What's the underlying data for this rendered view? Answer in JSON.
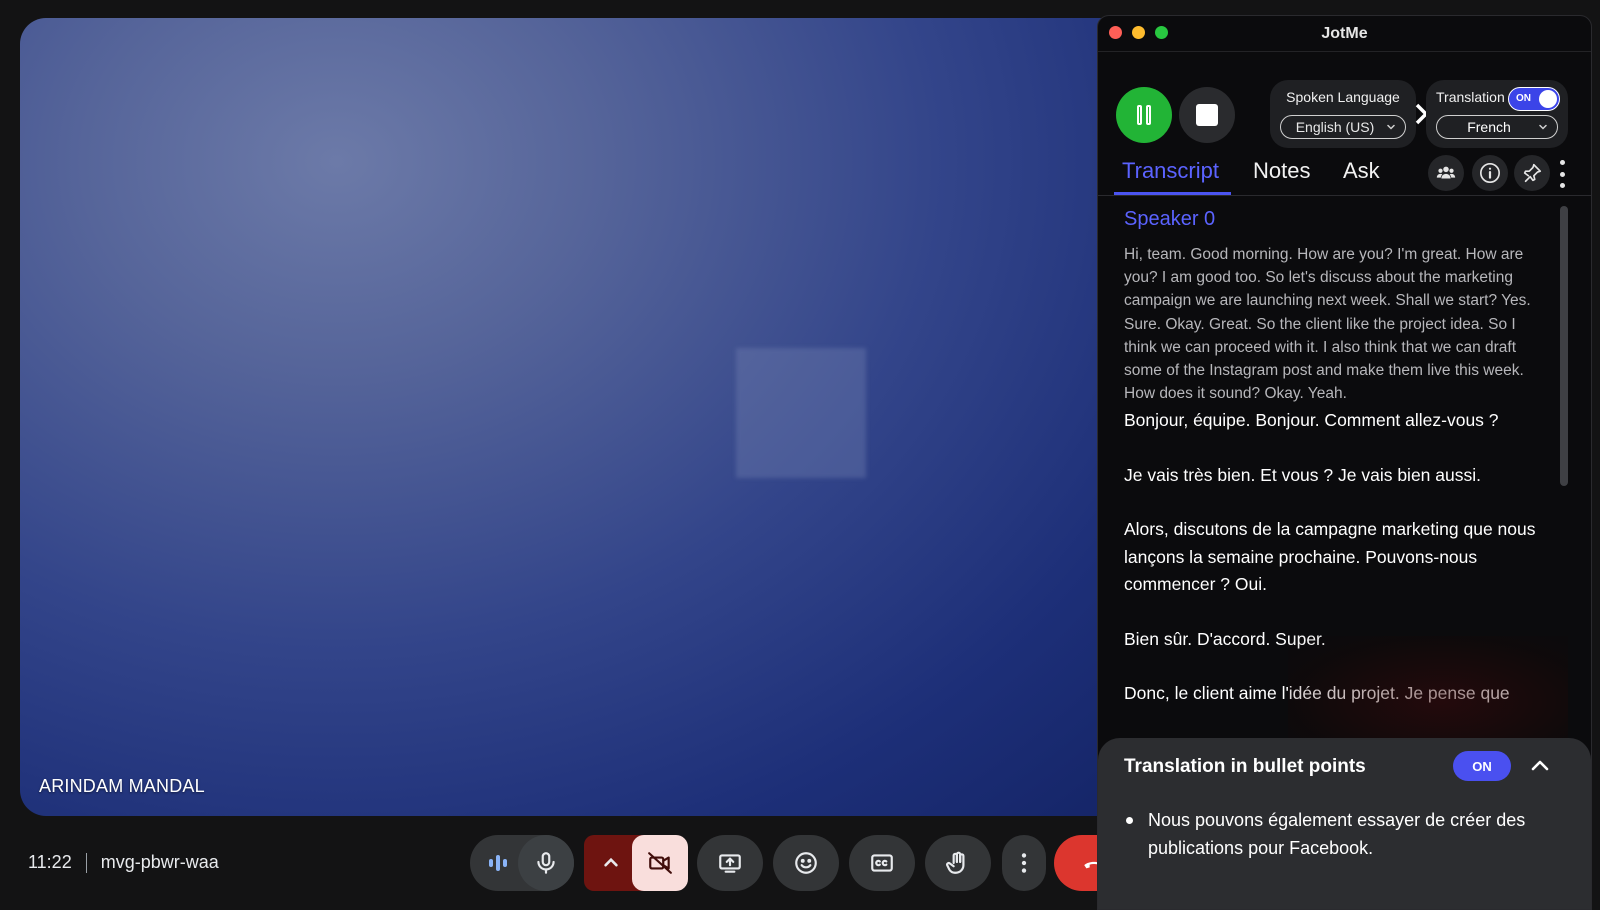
{
  "meet": {
    "participant_name": "ARINDAM MANDAL",
    "time": "11:22",
    "meeting_code": "mvg-pbwr-waa"
  },
  "jotme": {
    "window_title": "JotMe",
    "spoken_language_label": "Spoken Language",
    "spoken_language_value": "English (US)",
    "translation_label": "Translation",
    "translation_toggle": "ON",
    "translation_language_value": "French",
    "tabs": [
      {
        "label": "Transcript",
        "active": true
      },
      {
        "label": "Notes",
        "active": false
      },
      {
        "label": "Ask",
        "active": false
      }
    ],
    "transcript": {
      "speaker": "Speaker 0",
      "original": "Hi, team. Good morning. How are you? I'm great. How are you? I am good too. So let's discuss about the marketing campaign we are launching next week. Shall we start? Yes. Sure. Okay. Great. So the client like the project idea. So I think we can proceed with it. I also think that we can draft some of the Instagram post and make them live this week. How does it sound? Okay. Yeah.",
      "translated": [
        "Bonjour, équipe. Bonjour. Comment allez-vous ?",
        "Je vais très bien. Et vous ? Je vais bien aussi.",
        "Alors, discutons de la campagne marketing que nous lançons la semaine prochaine. Pouvons-nous commencer ? Oui.",
        "Bien sûr. D'accord. Super.",
        "Donc, le client aime l'idée du projet. Je pense que"
      ]
    },
    "bullet_panel": {
      "title": "Translation in bullet points",
      "toggle": "ON",
      "items": [
        "Nous pouvons également essayer de créer des publications pour Facebook."
      ]
    }
  },
  "colors": {
    "accent": "#4b54f0",
    "record_green": "#22b436",
    "end_call_red": "#dc362e",
    "camera_off_bg": "#f9dedc"
  }
}
